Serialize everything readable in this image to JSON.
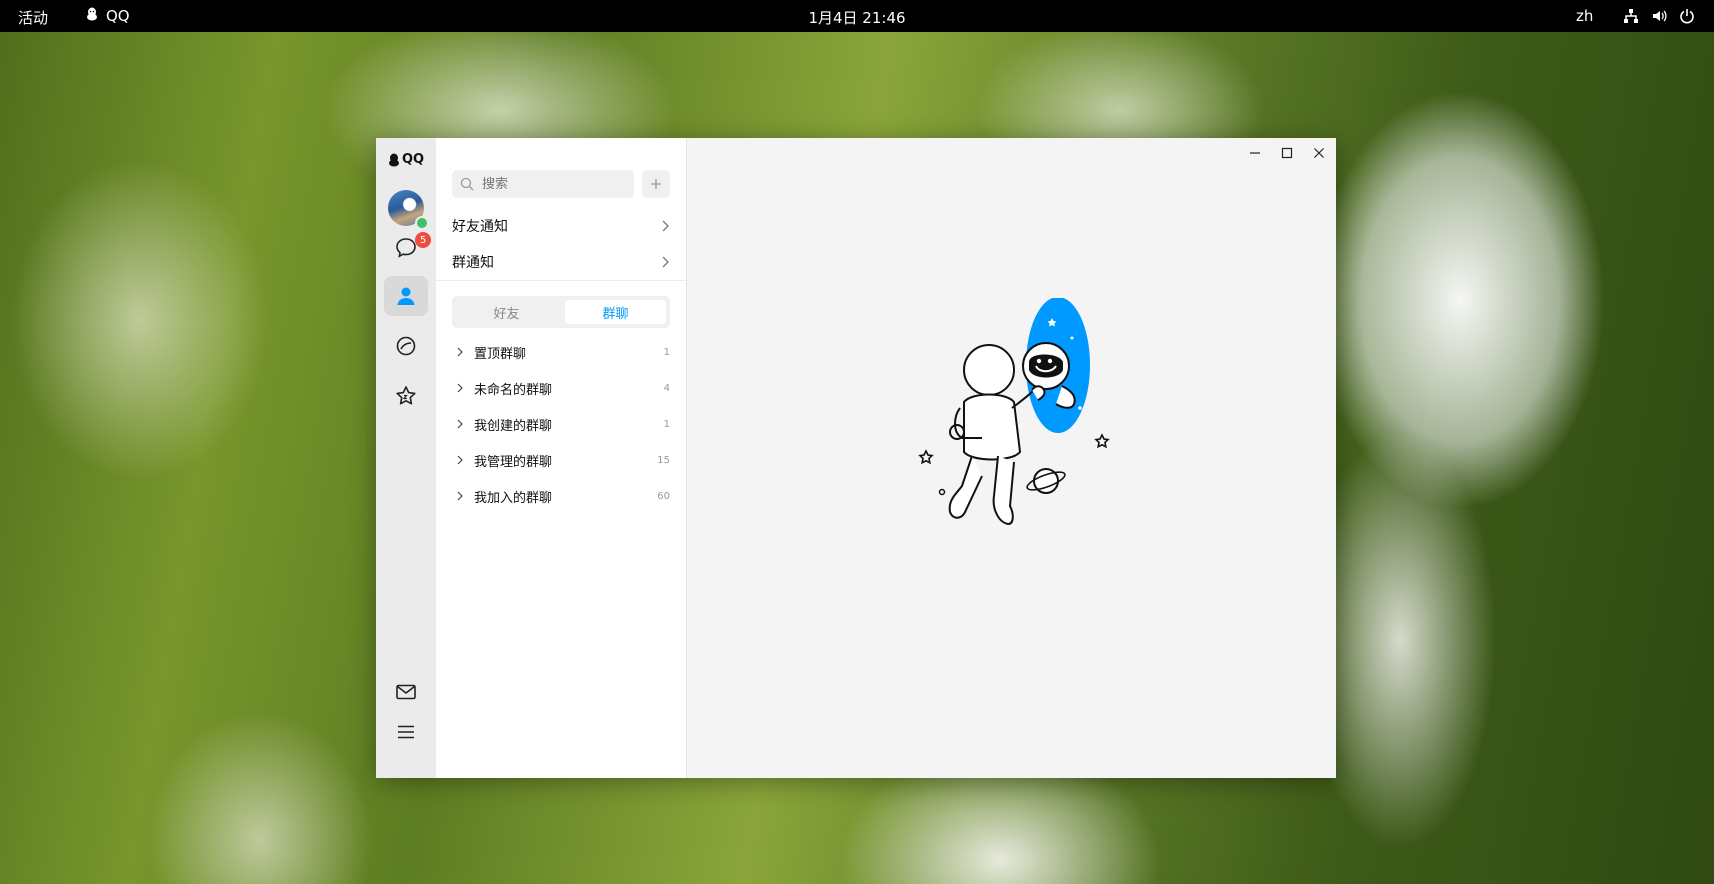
{
  "topbar": {
    "activities": "活动",
    "app_name": "QQ",
    "clock": "1月4日  21:46",
    "lang": "zh"
  },
  "window": {
    "brand": "QQ",
    "unread_count": "5",
    "search_placeholder": "搜索",
    "notices": [
      {
        "label": "好友通知"
      },
      {
        "label": "群通知"
      }
    ],
    "tabs": {
      "friends": "好友",
      "groups": "群聊",
      "active": "groups"
    },
    "groups": [
      {
        "name": "置顶群聊",
        "count": "1"
      },
      {
        "name": "未命名的群聊",
        "count": "4"
      },
      {
        "name": "我创建的群聊",
        "count": "1"
      },
      {
        "name": "我管理的群聊",
        "count": "15"
      },
      {
        "name": "我加入的群聊",
        "count": "60"
      }
    ],
    "accent_color": "#0099ff",
    "badge_color": "#f04b3e"
  }
}
